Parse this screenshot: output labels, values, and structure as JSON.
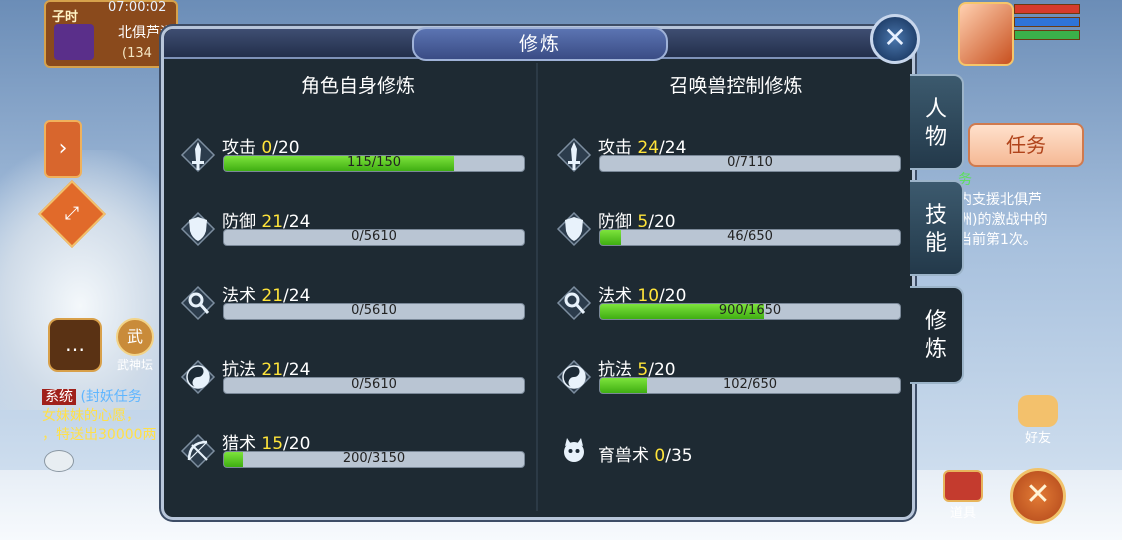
{
  "hud": {
    "time_period": "子时",
    "clock": "07:00:02",
    "server_name": "北俱芦洲",
    "server_sub": "(134",
    "task_button": "任务",
    "task_lines": [
      "务",
      "内支援北俱芦",
      "洲)的激战中的",
      "当前第1次。"
    ],
    "friend_label": "好友",
    "bag_label": "道具",
    "close_label": "✕",
    "wushen_icon_char": "武",
    "wushen_label": "武神坛",
    "system_tag": "系统",
    "system_line1": "(封妖任务",
    "system_line2": "女妹妹的心愿，",
    "system_line3": "，特送出30000两"
  },
  "dialog": {
    "title": "修炼",
    "close_label": "✕",
    "left_title": "角色自身修炼",
    "right_title": "召唤兽控制修炼",
    "left_rows": [
      {
        "name": "攻击",
        "current": "0",
        "max": "/20",
        "progress": "115/150",
        "fill": 0.767,
        "icon": "sword-icon"
      },
      {
        "name": "防御",
        "current": "21",
        "max": "/24",
        "progress": "0/5610",
        "fill": 0.0,
        "icon": "shield-icon"
      },
      {
        "name": "法术",
        "current": "21",
        "max": "/24",
        "progress": "0/5610",
        "fill": 0.0,
        "icon": "magic-icon"
      },
      {
        "name": "抗法",
        "current": "21",
        "max": "/24",
        "progress": "0/5610",
        "fill": 0.0,
        "icon": "yinyang-icon"
      },
      {
        "name": "猎术",
        "current": "15",
        "max": "/20",
        "progress": "200/3150",
        "fill": 0.063,
        "icon": "bow-icon"
      }
    ],
    "right_rows": [
      {
        "name": "攻击",
        "current": "24",
        "max": "/24",
        "progress": "0/7110",
        "fill": 0.0,
        "icon": "sword-icon"
      },
      {
        "name": "防御",
        "current": "5",
        "max": "/20",
        "progress": "46/650",
        "fill": 0.071,
        "icon": "shield-icon"
      },
      {
        "name": "法术",
        "current": "10",
        "max": "/20",
        "progress": "900/1650",
        "fill": 0.545,
        "icon": "magic-icon"
      },
      {
        "name": "抗法",
        "current": "5",
        "max": "/20",
        "progress": "102/650",
        "fill": 0.157,
        "icon": "yinyang-icon"
      },
      {
        "name": "育兽术",
        "current": "0",
        "max": "/35",
        "progress": "",
        "fill": null,
        "icon": "pet-icon"
      }
    ],
    "tabs": [
      {
        "label": "人\n物",
        "active": false
      },
      {
        "label": "技\n能",
        "active": false
      },
      {
        "label": "修\n炼",
        "active": true
      }
    ]
  }
}
